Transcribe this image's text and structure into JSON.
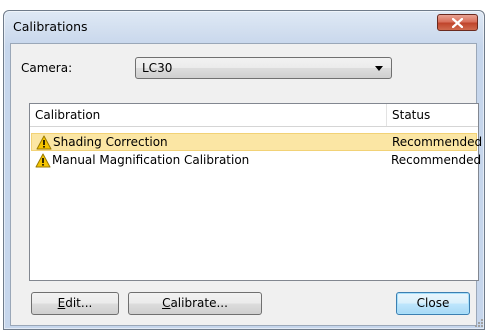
{
  "window": {
    "title": "Calibrations"
  },
  "camera": {
    "label": "Camera:",
    "selected_value": "LC30"
  },
  "list": {
    "columns": [
      "Calibration",
      "Status"
    ],
    "rows": [
      {
        "name": "Shading Correction",
        "status": "Recommended",
        "icon": "warning-icon",
        "selected": true
      },
      {
        "name": "Manual Magnification Calibration",
        "status": "Recommended",
        "icon": "warning-icon",
        "selected": false
      }
    ]
  },
  "buttons": {
    "edit": {
      "label": "Edit...",
      "mnemonic": "E"
    },
    "calibrate": {
      "label": "Calibrate...",
      "mnemonic": "C"
    },
    "close": {
      "label": "Close"
    }
  },
  "colors": {
    "selection_bg": "#fbe6a4",
    "close_button": "#c0452c",
    "warning": "#f5c400"
  }
}
